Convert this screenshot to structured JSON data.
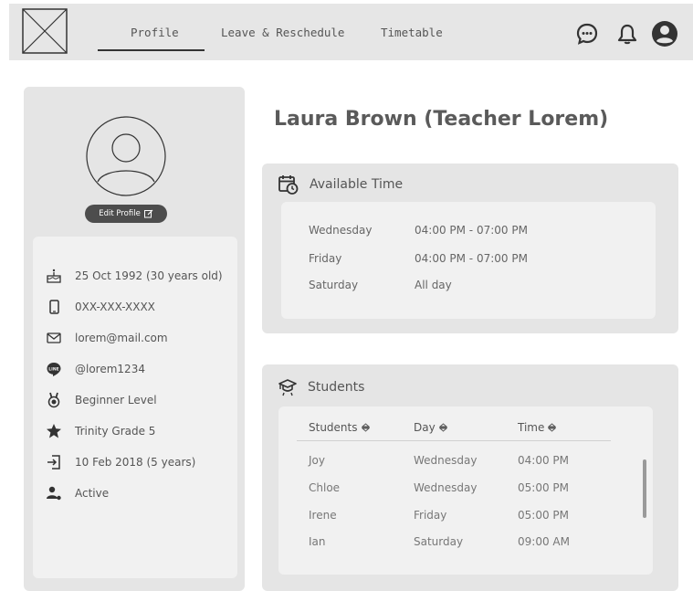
{
  "nav": {
    "tabs": [
      {
        "label": "Profile",
        "active": true
      },
      {
        "label": "Leave & Reschedule",
        "active": false
      },
      {
        "label": "Timetable",
        "active": false
      }
    ],
    "icons": [
      "chat-icon",
      "bell-icon",
      "user-icon"
    ]
  },
  "profile": {
    "edit_label": "Edit Profile",
    "info": [
      {
        "icon": "cake-icon",
        "text": "25 Oct 1992 (30 years old)"
      },
      {
        "icon": "phone-icon",
        "text": "0XX-XXX-XXXX"
      },
      {
        "icon": "mail-icon",
        "text": "lorem@mail.com"
      },
      {
        "icon": "line-icon",
        "text": "@lorem1234"
      },
      {
        "icon": "medal-icon",
        "text": "Beginner Level"
      },
      {
        "icon": "star-icon",
        "text": "Trinity Grade 5"
      },
      {
        "icon": "sign-in-icon",
        "text": "10 Feb 2018 (5 years)"
      },
      {
        "icon": "user-status-icon",
        "text": "Active"
      }
    ]
  },
  "main": {
    "name": "Laura Brown (Teacher Lorem)",
    "available": {
      "title": "Available Time",
      "rows": [
        {
          "day": "Wednesday",
          "time": "04:00 PM - 07:00 PM"
        },
        {
          "day": "Friday",
          "time": "04:00 PM - 07:00 PM"
        },
        {
          "day": "Saturday",
          "time": "All day"
        }
      ]
    },
    "students": {
      "title": "Students",
      "headers": [
        "Students",
        "Day",
        "Time"
      ],
      "rows": [
        {
          "name": "Joy",
          "day": "Wednesday",
          "time": "04:00 PM"
        },
        {
          "name": "Chloe",
          "day": "Wednesday",
          "time": "05:00 PM"
        },
        {
          "name": "Irene",
          "day": "Friday",
          "time": "05:00 PM"
        },
        {
          "name": "Ian",
          "day": "Saturday",
          "time": "09:00 AM"
        }
      ]
    }
  }
}
